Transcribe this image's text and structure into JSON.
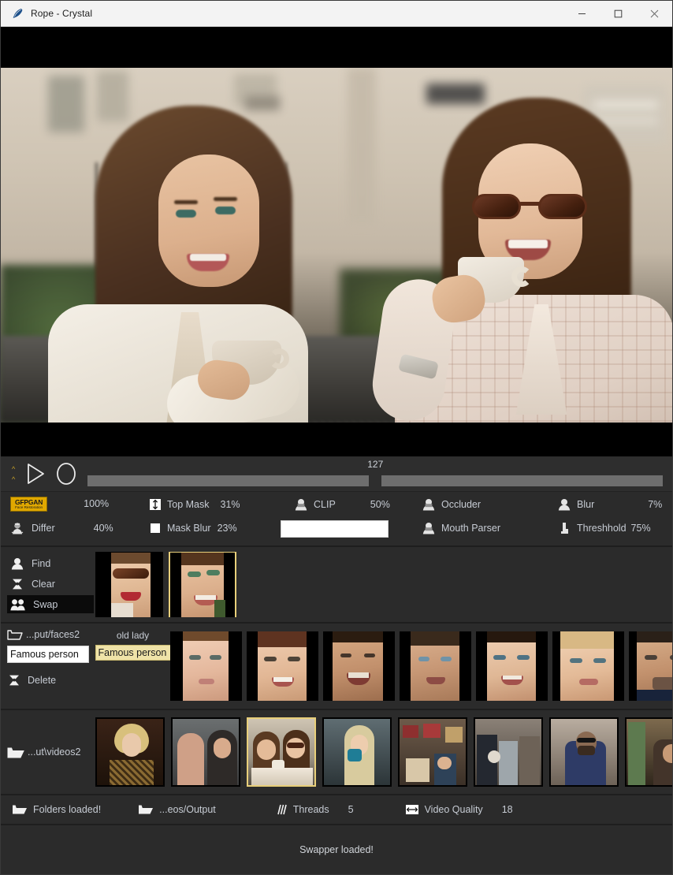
{
  "window": {
    "title": "Rope - Crystal",
    "app_icon": "feather-icon",
    "controls": {
      "minimize": "minimize-icon",
      "maximize": "maximize-icon",
      "close": "close-icon"
    }
  },
  "transport": {
    "prev_marker_icon": "chevron-up-icon",
    "next_marker_icon": "chevron-up-icon",
    "play_icon": "play-icon",
    "record_icon": "record-icon",
    "frame_value": "127",
    "slider_position_pct": 50
  },
  "parameters": {
    "row1": [
      {
        "name": "gfpgan",
        "icon": "gfpgan-badge",
        "label": "GFPGAN",
        "sublabel": "Face Restoration",
        "value": "100%",
        "active": true
      },
      {
        "name": "top-mask",
        "icon": "vertical-arrows-icon",
        "label": "Top Mask",
        "value": "31%",
        "active": false
      },
      {
        "name": "clip",
        "icon": "person-mask-icon",
        "label": "CLIP",
        "value": "50%",
        "active": false
      },
      {
        "name": "occluder",
        "icon": "person-mask-icon",
        "label": "Occluder",
        "value": "",
        "active": false
      },
      {
        "name": "blur",
        "icon": "person-icon",
        "label": "Blur",
        "value": "7%",
        "active": false
      }
    ],
    "row2": [
      {
        "name": "differ",
        "icon": "differ-icon",
        "label": "Differ",
        "value": "40%",
        "active": false
      },
      {
        "name": "mask-blur",
        "icon": "square-icon",
        "label": "Mask Blur",
        "value": "23%",
        "active": false
      },
      {
        "name": "mouth-parser",
        "icon": "person-mask-icon",
        "label": "Mouth Parser",
        "value": "",
        "active": false
      },
      {
        "name": "threshhold",
        "icon": "threshold-icon",
        "label": "Threshhold",
        "value": "75%",
        "active": false
      }
    ],
    "clip_text": {
      "value": "",
      "placeholder": ""
    }
  },
  "find_panel": {
    "buttons": [
      {
        "name": "find",
        "icon": "person-icon",
        "label": "Find",
        "active": false
      },
      {
        "name": "clear",
        "icon": "person-x-icon",
        "label": "Clear",
        "active": false
      },
      {
        "name": "swap",
        "icon": "two-people-icon",
        "label": "Swap",
        "active": true
      }
    ],
    "found_faces": [
      {
        "id": 1,
        "selected": false,
        "alt": "woman-with-sunglasses-red-lips"
      },
      {
        "id": 2,
        "selected": true,
        "alt": "woman-green-eyeshadow-smiling"
      }
    ]
  },
  "face_library": {
    "folder_label": "...put/faces2",
    "folder_icon": "folder-open-icon",
    "name_input_value": "Famous person",
    "delete_label": "Delete",
    "delete_icon": "delete-x-icon",
    "group_label": "old lady",
    "selected_tag": "Famous person",
    "faces": [
      {
        "id": 1,
        "alt": "young-woman-neutral"
      },
      {
        "id": 2,
        "alt": "woman-bangs-smiling"
      },
      {
        "id": 3,
        "alt": "elderly-woman-laughing"
      },
      {
        "id": 4,
        "alt": "elderly-woman-blue-eyes"
      },
      {
        "id": 5,
        "alt": "woman-dark-hair-smiling"
      },
      {
        "id": 6,
        "alt": "blonde-woman-portrait"
      },
      {
        "id": 7,
        "alt": "man-dark-hair"
      }
    ]
  },
  "video_library": {
    "folder_label": "...ut\\videos2",
    "folder_icon": "folder-open-icon",
    "videos": [
      {
        "id": 1,
        "selected": false,
        "alt": "blonde-woman-leopard-dress"
      },
      {
        "id": 2,
        "selected": false,
        "alt": "two-women-conversation"
      },
      {
        "id": 3,
        "selected": true,
        "alt": "two-women-cafe-coffee"
      },
      {
        "id": 4,
        "selected": false,
        "alt": "blonde-woman-blue-cup"
      },
      {
        "id": 5,
        "selected": false,
        "alt": "living-room-group"
      },
      {
        "id": 6,
        "selected": false,
        "alt": "crowd-indoor-scene"
      },
      {
        "id": 7,
        "selected": false,
        "alt": "bearded-man-blue-jacket"
      },
      {
        "id": 8,
        "selected": false,
        "alt": "man-hallway-scene"
      }
    ]
  },
  "bottom_bar": {
    "items": [
      {
        "name": "folders-loaded",
        "icon": "folder-open-icon",
        "label": "Folders loaded!",
        "value": ""
      },
      {
        "name": "output-folder",
        "icon": "folder-open-icon",
        "label": "...eos/Output",
        "value": ""
      },
      {
        "name": "threads",
        "icon": "threads-icon",
        "label": "Threads",
        "value": "5"
      },
      {
        "name": "video-quality",
        "icon": "arrows-horizontal-icon",
        "label": "Video Quality",
        "value": "18"
      }
    ]
  },
  "status_bar": {
    "message": "Swapper loaded!"
  },
  "colors": {
    "accent_gold": "#e8cf7a",
    "badge_yellow": "#e0a800",
    "panel_bg": "#2b2b2b",
    "text": "#c7ccd4",
    "titlebar_bg": "#f3f3f3"
  }
}
